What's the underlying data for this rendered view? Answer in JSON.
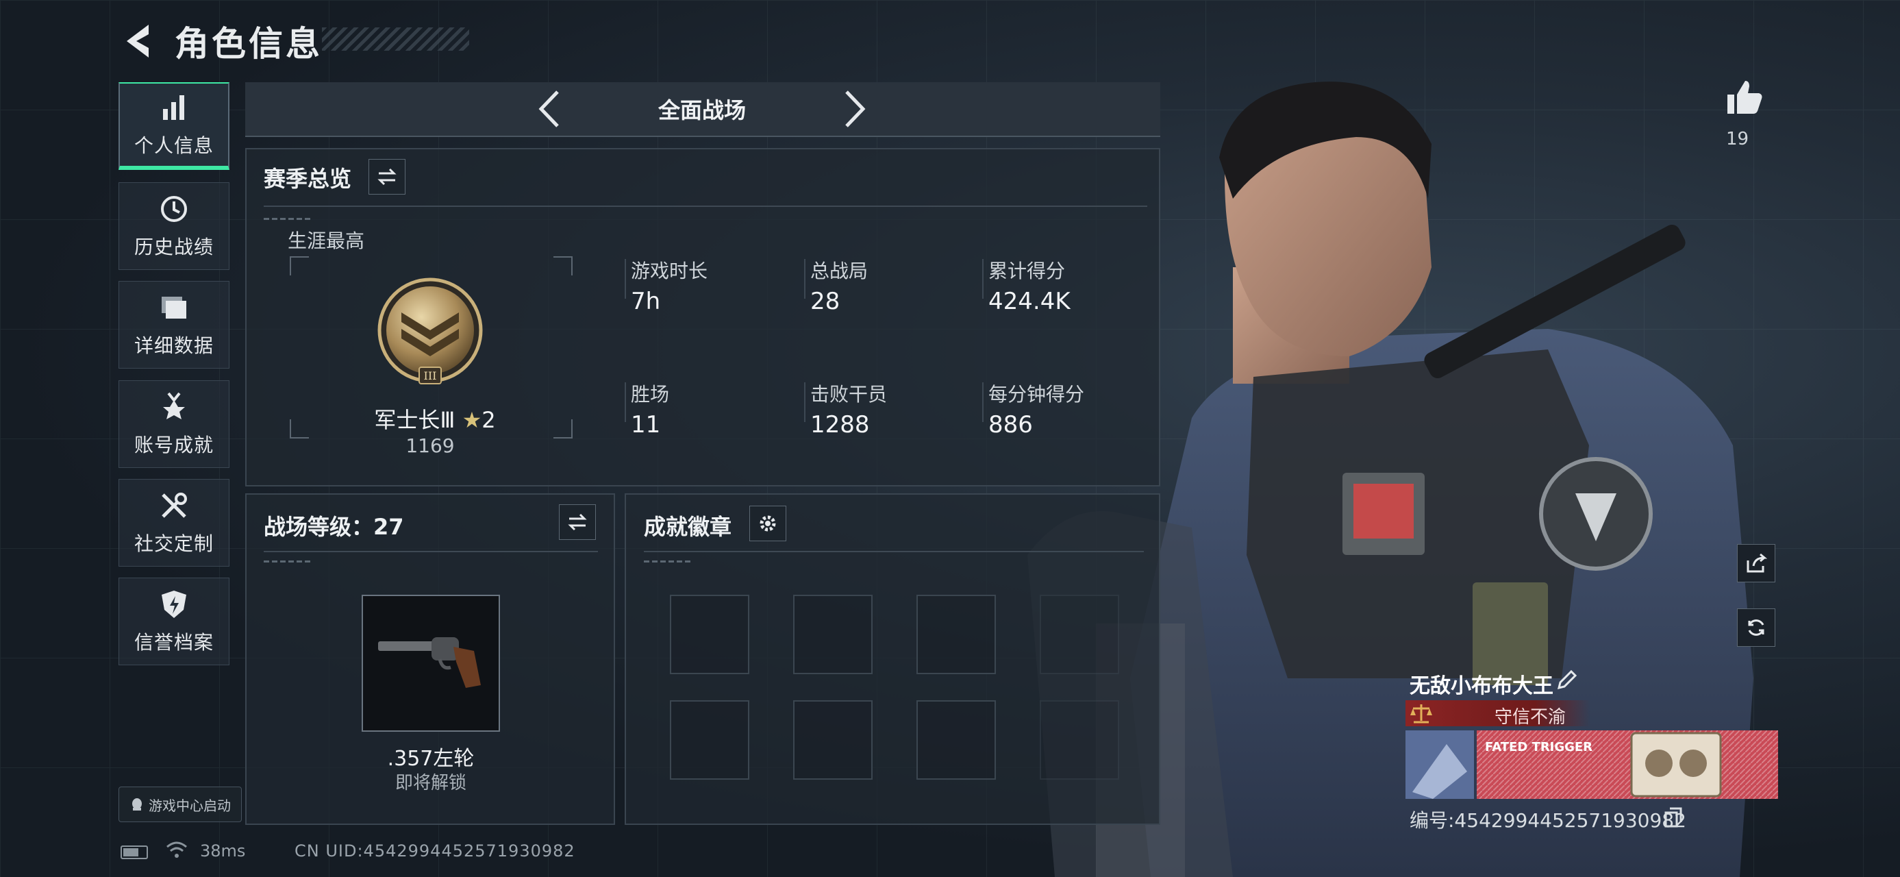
{
  "header": {
    "title": "角色信息"
  },
  "sidebar": {
    "items": [
      {
        "label": "个人信息",
        "icon": "bar-chart-icon",
        "active": true
      },
      {
        "label": "历史战绩",
        "icon": "clock-history-icon",
        "active": false
      },
      {
        "label": "详细数据",
        "icon": "folder-icon",
        "active": false
      },
      {
        "label": "账号成就",
        "icon": "medal-icon",
        "active": false
      },
      {
        "label": "社交定制",
        "icon": "tools-icon",
        "active": false
      },
      {
        "label": "信誉档案",
        "icon": "shield-icon",
        "active": false
      }
    ],
    "game_center": "游戏中心启动"
  },
  "status": {
    "ping": "38ms",
    "uid": "CN UID:4542994452571930982"
  },
  "mode": {
    "label": "全面战场"
  },
  "season": {
    "title": "赛季总览",
    "career_label": "生涯最高",
    "rank": {
      "name": "军士长Ⅲ",
      "stars": "2",
      "points": "1169",
      "emblem_numeral": "III"
    },
    "stats": [
      {
        "label": "游戏时长",
        "value": "7h"
      },
      {
        "label": "总战局",
        "value": "28"
      },
      {
        "label": "累计得分",
        "value": "424.4K"
      },
      {
        "label": "胜场",
        "value": "11"
      },
      {
        "label": "击败干员",
        "value": "1288"
      },
      {
        "label": "每分钟得分",
        "value": "886"
      }
    ]
  },
  "battle_level": {
    "label": "战场等级：27",
    "weapon_name": ".357左轮",
    "weapon_status": "即将解锁"
  },
  "achievements": {
    "title": "成就徽章"
  },
  "profile": {
    "likes": "19",
    "name": "无敌小布布大王",
    "title": "守信不渝",
    "id": "编号:4542994452571930982",
    "banner_text": "FATED TRIGGER"
  },
  "colors": {
    "accent": "#3ee8a4",
    "title_red": "#8c2424",
    "bg": "#151c24"
  }
}
